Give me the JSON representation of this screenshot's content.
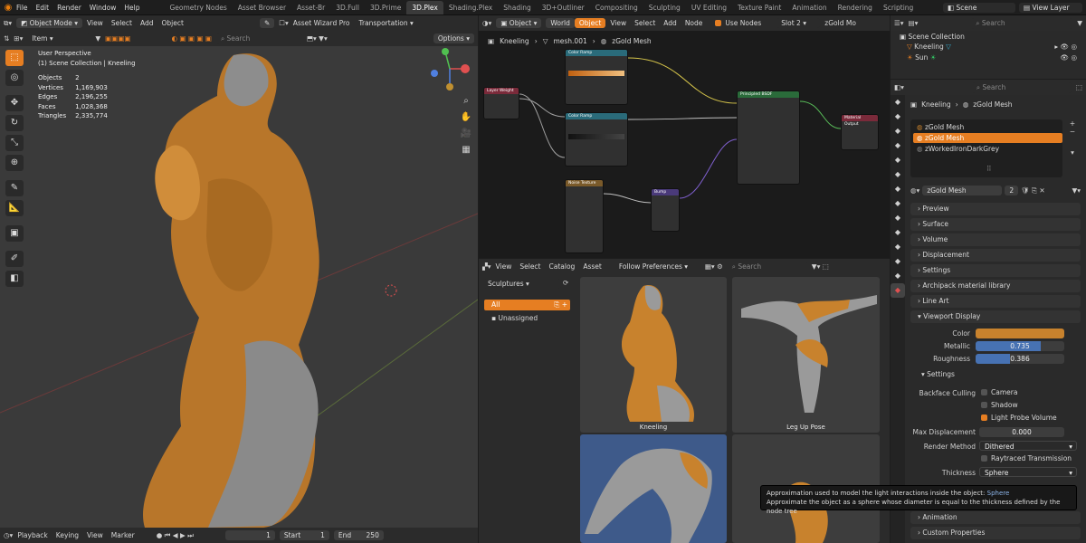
{
  "topbar": {
    "menus": [
      "File",
      "Edit",
      "Render",
      "Window",
      "Help"
    ],
    "tabs": [
      "Geometry Nodes",
      "Asset Browser",
      "Asset-Br",
      "3D.Full",
      "3D.Prime",
      "3D.Plex",
      "Shading.Plex",
      "Shading",
      "3D+Outliner",
      "Compositing",
      "Sculpting",
      "UV Editing",
      "Texture Paint",
      "Animation",
      "Rendering",
      "Scripting"
    ],
    "active_tab": "3D.Plex",
    "scene": "Scene",
    "view_layer": "View Layer"
  },
  "viewport": {
    "mode": "Object Mode",
    "menus": [
      "View",
      "Select",
      "Add",
      "Object"
    ],
    "addon": "Asset Wizard Pro",
    "transform": "Transportation",
    "orientation": "Item",
    "search_placeholder": "Search",
    "options": "Options",
    "perspective": "User Perspective",
    "collection": "(1) Scene Collection | Kneeling",
    "stats": [
      {
        "k": "Objects",
        "v": "2"
      },
      {
        "k": "Vertices",
        "v": "1,169,903"
      },
      {
        "k": "Edges",
        "v": "2,196,255"
      },
      {
        "k": "Faces",
        "v": "1,028,368"
      },
      {
        "k": "Triangles",
        "v": "2,335,774"
      }
    ],
    "tools": [
      "select-icon",
      "cursor-icon",
      "move-icon",
      "rotate-icon",
      "scale-icon",
      "transform-icon",
      "annotate-icon",
      "measure-icon",
      "add-cube-icon",
      "edit-icon",
      "shade-icon"
    ],
    "tool_glyphs": [
      "⬚",
      "◎",
      "✥",
      "↻",
      "⤡",
      "⊕",
      "✎",
      "📐",
      "▣",
      "✐",
      "◧"
    ],
    "colors": {
      "gold": "#c8822d",
      "background": "#3a3a3a",
      "accent": "#e67e22"
    }
  },
  "timeline": {
    "menus": [
      "Playback",
      "Keying",
      "View",
      "Marker"
    ],
    "frame": "1",
    "start_label": "Start",
    "start": "1",
    "end_label": "End",
    "end": "250"
  },
  "node_editor": {
    "type": "Object",
    "world": "World",
    "object": "Object",
    "menus": [
      "View",
      "Select",
      "Add",
      "Node"
    ],
    "use_nodes": "Use Nodes",
    "slot": "Slot 2",
    "material": "zGold Mo",
    "breadcrumb": [
      "Kneeling",
      "mesh.001",
      "zGold Mesh"
    ],
    "nodes": {
      "layer_weight": "Layer Weight",
      "color_ramp1": "Color Ramp",
      "color_ramp2": "Color Ramp",
      "bsdf": "Principled BSDF",
      "output": "Material Output",
      "noise": "Noise Texture",
      "bump": "Bump"
    }
  },
  "asset_browser": {
    "menus": [
      "View",
      "Select",
      "Catalog",
      "Asset"
    ],
    "library": "Follow Preferences",
    "search_placeholder": "Search",
    "category": "Sculptures",
    "catalogs": [
      "All",
      "Unassigned"
    ],
    "assets": [
      "Kneeling",
      "Leg Up Pose",
      "",
      ""
    ]
  },
  "outliner": {
    "search_placeholder": "Search",
    "root": "Scene Collection",
    "items": [
      "Kneeling",
      "Sun"
    ]
  },
  "properties": {
    "search_placeholder": "Search",
    "breadcrumb": [
      "Kneeling",
      "zGold Mesh"
    ],
    "slots": [
      "zGold Mesh",
      "zGold Mesh",
      "zWorkedIronDarkGrey"
    ],
    "slot_extra": "⠿",
    "material_name": "zGold Mesh",
    "users": "2",
    "panels_top": [
      "Preview",
      "Surface",
      "Volume",
      "Displacement",
      "Settings",
      "Archipack material library",
      "Line Art"
    ],
    "viewport_display": "Viewport Display",
    "color_label": "Color",
    "metallic_label": "Metallic",
    "metallic": "0.735",
    "metallic_value": 0.735,
    "roughness_label": "Roughness",
    "roughness": "0.386",
    "roughness_value": 0.386,
    "settings": "Settings",
    "backface_culling": "Backface Culling",
    "camera": "Camera",
    "shadow": "Shadow",
    "light_probe": "Light Probe Volume",
    "max_disp_label": "Max Displacement",
    "max_disp": "0.000",
    "render_method_label": "Render Method",
    "render_method": "Dithered",
    "raytraced": "Raytraced Transmission",
    "thickness_label": "Thickness",
    "thickness": "Sphere",
    "panels_bottom": [
      "Animation",
      "Custom Properties"
    ],
    "gold_color": "#c8822d"
  },
  "tooltip": {
    "title": "Approximation used to model the light interactions inside the object:",
    "value": "Sphere",
    "desc": "Approximate the object as a sphere whose diameter is equal to the thickness defined by the node tree"
  }
}
